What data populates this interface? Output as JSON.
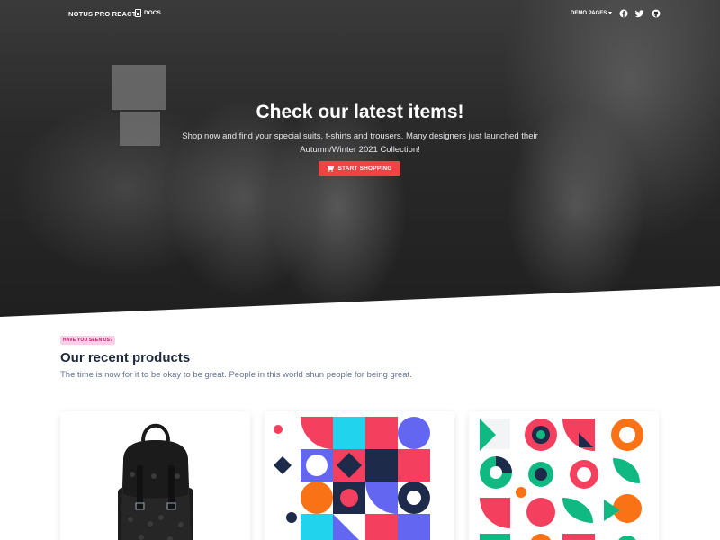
{
  "nav": {
    "brand": "NOTUS PRO REACT",
    "docs_label": "DOCS",
    "demo_pages_label": "DEMO PAGES",
    "social_icons": [
      "facebook-icon",
      "twitter-icon",
      "github-icon"
    ]
  },
  "hero": {
    "title": "Check our latest items!",
    "text": "Shop now and find your special suits, t-shirts and trousers. Many designers just launched their Autumn/Winter 2021 Collection!",
    "button_label": "START SHOPPING",
    "button_color": "#ef4444"
  },
  "section": {
    "badge": "HAVE YOU SEEN US?",
    "title": "Our recent products",
    "subtitle": "The time is now for it to be okay to be great. People in this world shun people for being great."
  },
  "colors": {
    "accent_red": "#ef4444",
    "badge_bg": "#fbcfe8",
    "badge_text": "#be185d",
    "pattern_red": "#f43f5e",
    "pattern_navy": "#1e2a4a",
    "pattern_cyan": "#22d3ee",
    "pattern_purple": "#6366f1",
    "pattern_orange": "#f97316",
    "pattern_green": "#10b981"
  }
}
